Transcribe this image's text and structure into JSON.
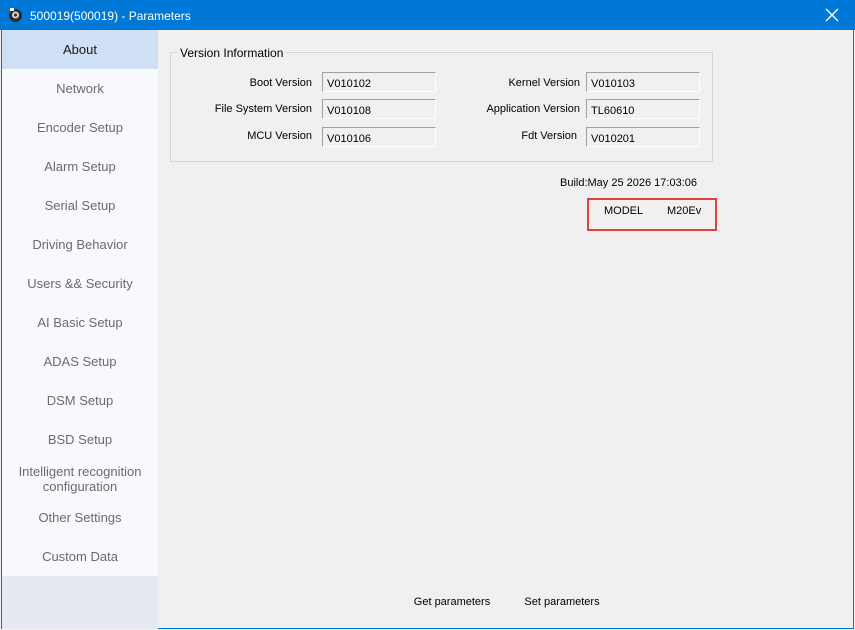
{
  "window": {
    "title": "500019(500019) - Parameters",
    "icons": {
      "app": "app-icon",
      "close": "close-icon"
    }
  },
  "sidebar": {
    "items": [
      {
        "label": "About"
      },
      {
        "label": "Network"
      },
      {
        "label": "Encoder Setup"
      },
      {
        "label": "Alarm Setup"
      },
      {
        "label": "Serial Setup"
      },
      {
        "label": "Driving Behavior"
      },
      {
        "label": "Users && Security"
      },
      {
        "label": "AI Basic Setup"
      },
      {
        "label": "ADAS Setup"
      },
      {
        "label": "DSM Setup"
      },
      {
        "label": "BSD Setup"
      },
      {
        "label": "Intelligent recognition configuration"
      },
      {
        "label": "Other Settings"
      },
      {
        "label": "Custom Data"
      }
    ],
    "active_index": 0
  },
  "version_info": {
    "title": "Version Information",
    "fields": [
      {
        "label": "Boot Version",
        "value": "V010102"
      },
      {
        "label": "Kernel Version",
        "value": "V010103"
      },
      {
        "label": "File System Version",
        "value": "V010108"
      },
      {
        "label": "Application Version",
        "value": "TL60610"
      },
      {
        "label": "MCU Version",
        "value": "V010106"
      },
      {
        "label": "Fdt Version",
        "value": "V010201"
      }
    ]
  },
  "build": "Build:May 25 2026 17:03:06",
  "model": {
    "label": "MODEL",
    "value": "M20Ev"
  },
  "colors": {
    "titlebar": "#0078d7",
    "highlight": "#e5413b",
    "active_nav": "#cfe0f5"
  },
  "buttons": {
    "get": "Get parameters",
    "set": "Set parameters"
  }
}
